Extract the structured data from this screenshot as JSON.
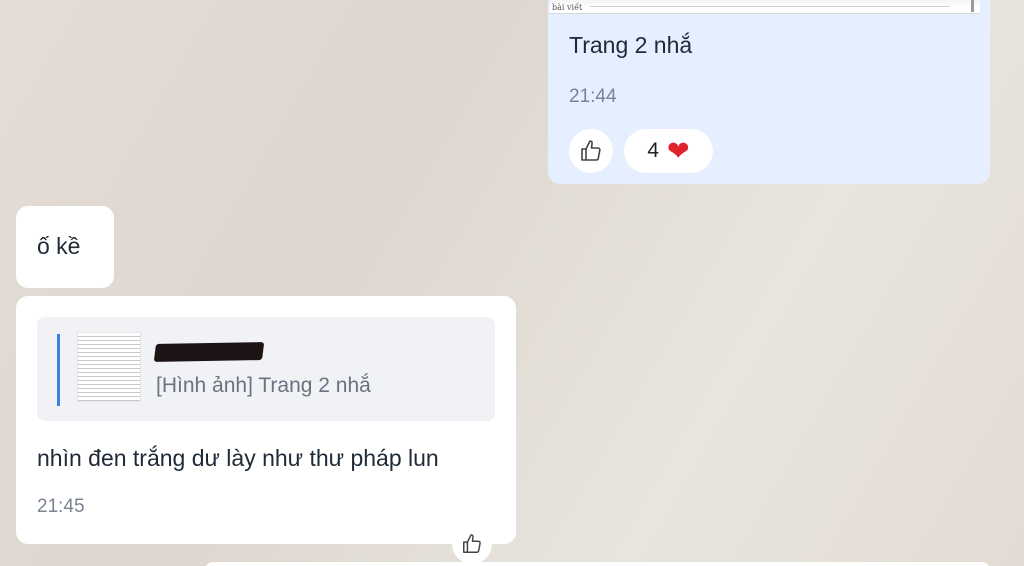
{
  "outgoing": {
    "image_caption": "bài viết",
    "text": "Trang 2 nhắ",
    "time": "21:44",
    "reaction_count": "4",
    "reaction_icon": "heart-icon",
    "like_icon": "thumbs-up-icon",
    "heart_color": "#e0242c"
  },
  "incoming_short": {
    "text": "ố kề"
  },
  "incoming_reply": {
    "quote_text": "[Hình ảnh] Trang 2 nhắ",
    "text": "nhìn đen trắng dư lày như thư pháp lun",
    "time": "21:45",
    "like_icon": "thumbs-up-icon"
  },
  "colors": {
    "outgoing_bubble": "#e5efff",
    "incoming_bubble": "#ffffff",
    "quote_bar": "#3b82e0"
  }
}
